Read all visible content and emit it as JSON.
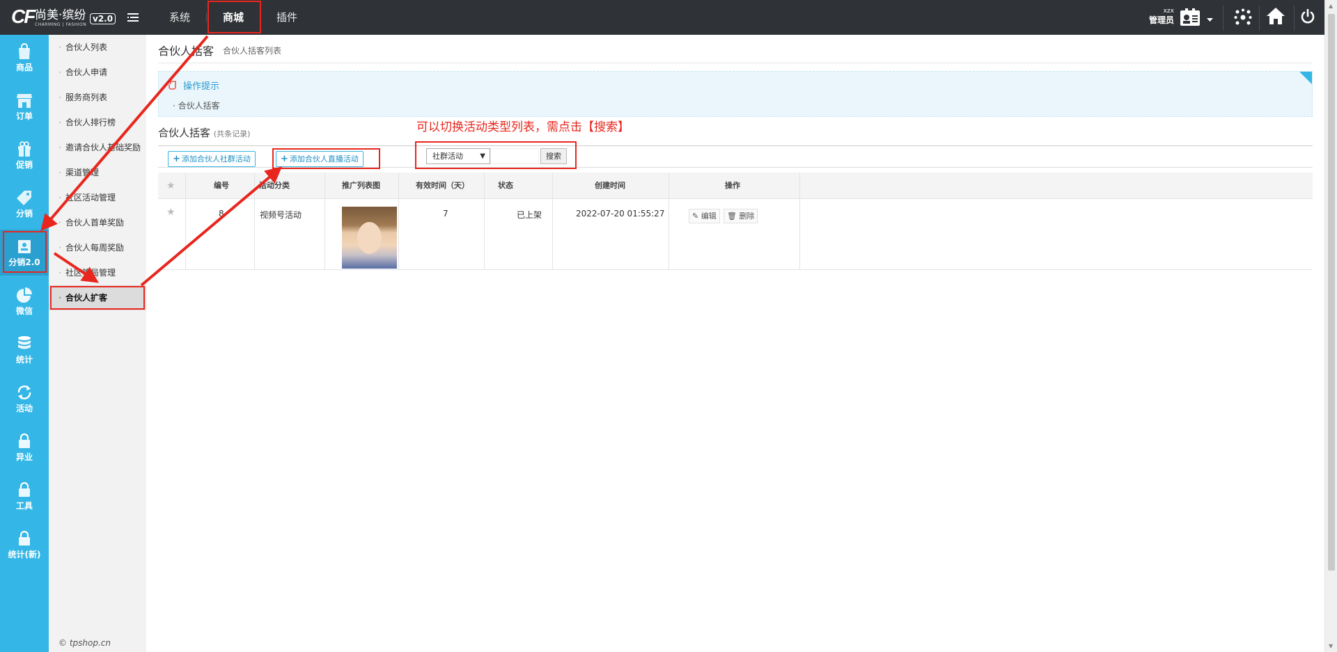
{
  "header": {
    "logo_mark": "CF",
    "logo_text": "尚美·缤纷",
    "logo_sub": "CHARMING | FASHION",
    "version": "v2.0",
    "nav": [
      "系统",
      "商城",
      "插件"
    ],
    "user_name": "xzx",
    "user_role": "管理员"
  },
  "sidebar1": [
    {
      "label": "商品",
      "icon": "bag-icon"
    },
    {
      "label": "订单",
      "icon": "shop-icon"
    },
    {
      "label": "促销",
      "icon": "gift-icon"
    },
    {
      "label": "分销",
      "icon": "tag-icon"
    },
    {
      "label": "分销2.0",
      "icon": "id-card-icon"
    },
    {
      "label": "微信",
      "icon": "pie-icon"
    },
    {
      "label": "统计",
      "icon": "database-icon"
    },
    {
      "label": "活动",
      "icon": "refresh-icon"
    },
    {
      "label": "异业",
      "icon": "lock-icon"
    },
    {
      "label": "工具",
      "icon": "lock-icon"
    },
    {
      "label": "统计(新)",
      "icon": "lock-icon"
    }
  ],
  "sidebar2": [
    "合伙人列表",
    "合伙人申请",
    "服务商列表",
    "合伙人排行榜",
    "邀请合伙人基础奖励",
    "渠道管理",
    "社区活动管理",
    "合伙人首单奖励",
    "合伙人每周奖励",
    "社区管局管理",
    "合伙人扩客"
  ],
  "copyright": "© tpshop.cn",
  "page": {
    "title": "合伙人括客",
    "subtitle": "合伙人括客列表",
    "tips_title": "操作提示",
    "tips_line": "合伙人括客",
    "list_title": "合伙人括客",
    "list_count": "(共条记录)",
    "btn_add_community": "添加合伙人社群活动",
    "btn_add_live": "添加合伙人直播活动",
    "select_value": "社群活动",
    "search_btn": "搜索",
    "annotation": "可以切换活动类型列表，需点击【搜索】"
  },
  "table": {
    "headers": [
      "编号",
      "活动分类",
      "推广列表图",
      "有效时间（天）",
      "状态",
      "创建时间",
      "操作"
    ],
    "rows": [
      {
        "id": "8",
        "category": "视频号活动",
        "days": "7",
        "status": "已上架",
        "created": "2022-07-20 01:55:27",
        "edit": "编辑",
        "delete": "删除"
      }
    ]
  },
  "colors": {
    "accent": "#34b6e6",
    "topbar": "#2f3236",
    "annotation": "#e8261e"
  }
}
